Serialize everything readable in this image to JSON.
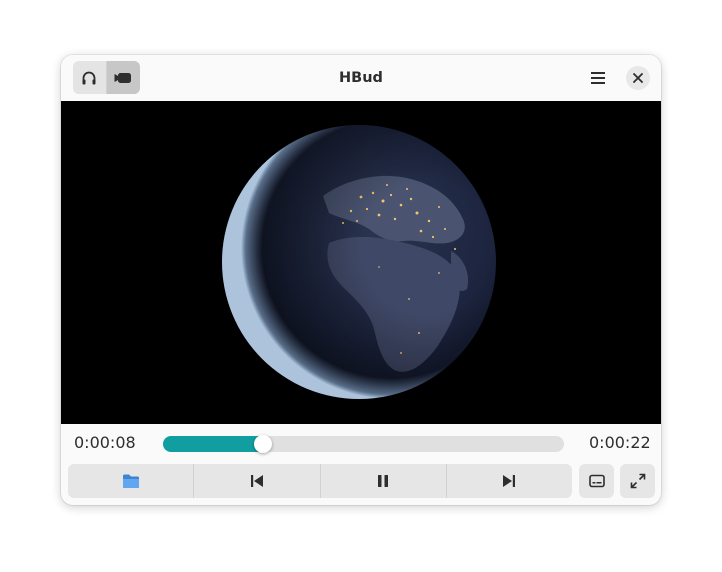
{
  "window": {
    "title": "HBud"
  },
  "header": {
    "mode_switch": [
      {
        "icon": "headphones-icon",
        "active": false
      },
      {
        "icon": "video-camera-icon",
        "active": true
      }
    ],
    "menu_icon": "hamburger-menu-icon",
    "close_icon": "close-icon"
  },
  "player": {
    "current_time": "0:00:08",
    "duration": "0:00:22",
    "progress_fraction": 0.25
  },
  "controls": {
    "buttons": [
      {
        "name": "open-folder-button",
        "icon": "folder-icon"
      },
      {
        "name": "previous-button",
        "icon": "skip-previous-icon"
      },
      {
        "name": "pause-button",
        "icon": "pause-icon"
      },
      {
        "name": "next-button",
        "icon": "skip-next-icon"
      }
    ],
    "side_buttons": [
      {
        "name": "subtitles-button",
        "icon": "subtitles-icon"
      },
      {
        "name": "fullscreen-button",
        "icon": "fullscreen-icon"
      }
    ]
  },
  "colors": {
    "accent": "#119ea1",
    "folder": "#4a90d9",
    "video_background": "#000000"
  }
}
